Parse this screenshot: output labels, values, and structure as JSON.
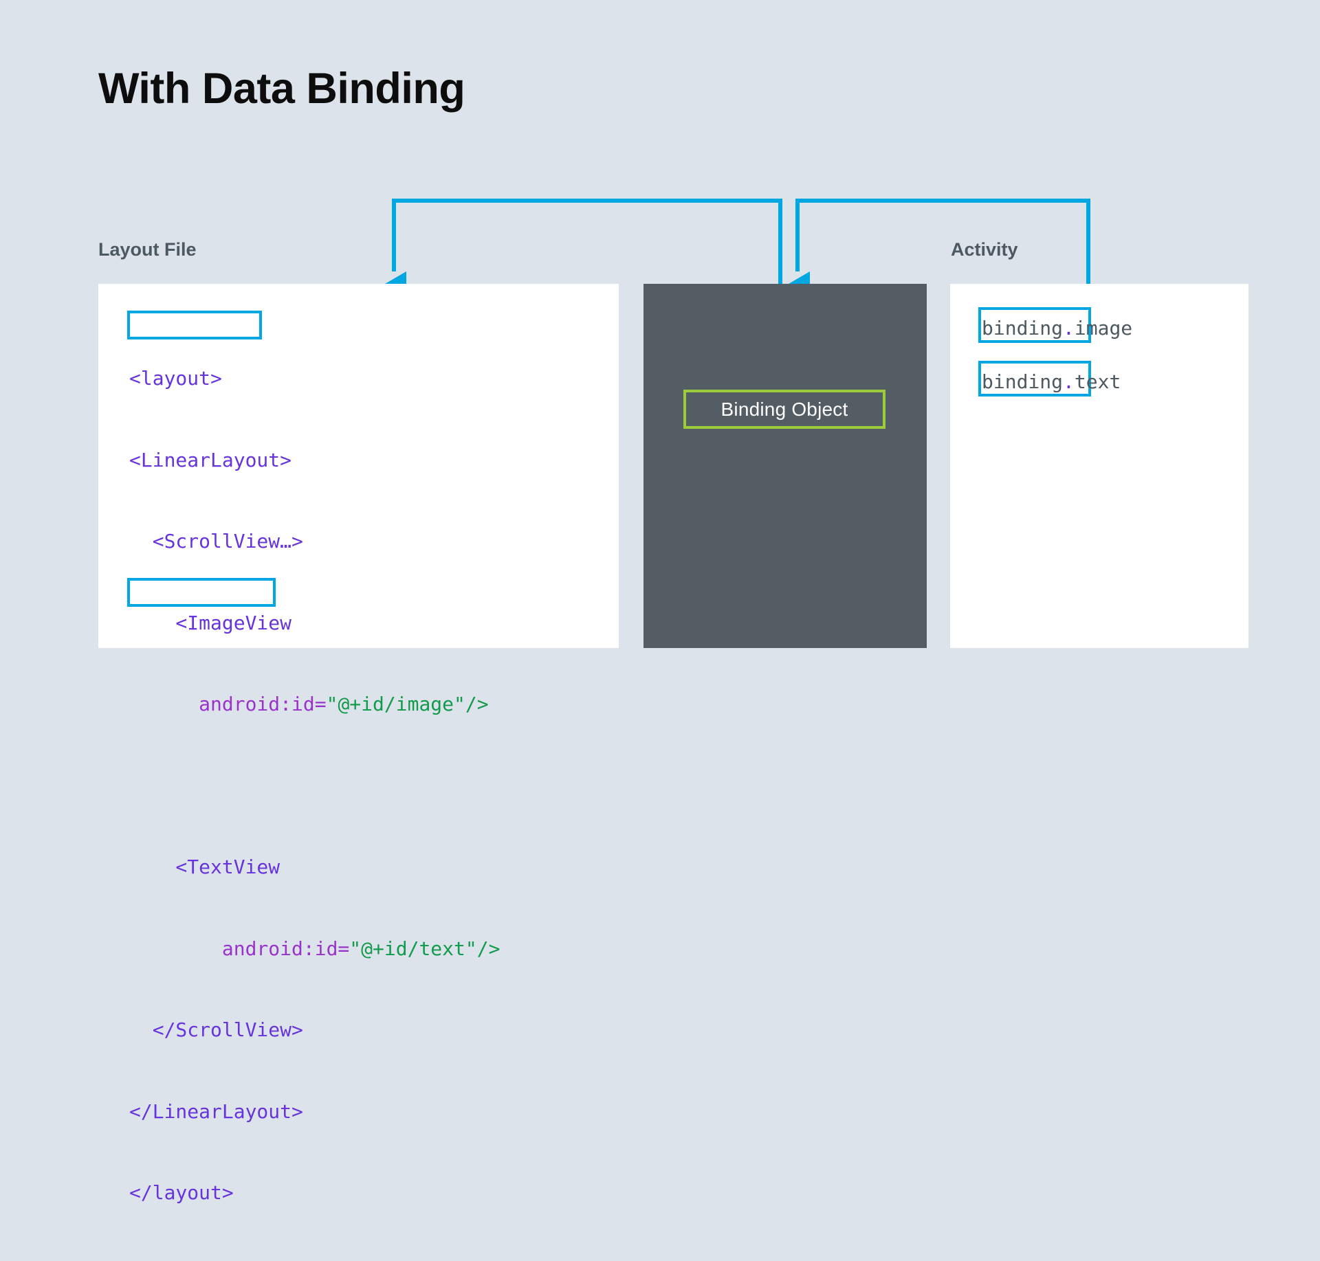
{
  "page": {
    "title": "With Data Binding",
    "background_color": "#dde3ea",
    "accent_color": "#00a7e1",
    "chip_border_color": "#9ccb3b",
    "dark_panel_color": "#545d64",
    "label_color": "#4d5960"
  },
  "labels": {
    "layout_file": "Layout File",
    "activity": "Activity"
  },
  "layout_file_panel": {
    "code_lines": [
      {
        "indent": 0,
        "tag": "<layout>",
        "attr": "",
        "str": "",
        "tail": "",
        "highlighted": true
      },
      {
        "indent": 0,
        "tag": "<LinearLayout>",
        "attr": "",
        "str": "",
        "tail": "",
        "highlighted": false
      },
      {
        "indent": 1,
        "tag": "<ScrollView…>",
        "attr": "",
        "str": "",
        "tail": "",
        "highlighted": false
      },
      {
        "indent": 2,
        "tag": "<ImageView",
        "attr": "",
        "str": "",
        "tail": "",
        "highlighted": false
      },
      {
        "indent": 3,
        "tag": "",
        "attr": "android:id=",
        "str": "\"@+id/image\"",
        "tail": "/>",
        "highlighted": false
      },
      {
        "indent": 0,
        "tag": "",
        "attr": "",
        "str": "",
        "tail": "",
        "highlighted": false
      },
      {
        "indent": 2,
        "tag": "<TextView",
        "attr": "",
        "str": "",
        "tail": "",
        "highlighted": false
      },
      {
        "indent": 3,
        "tag": "",
        "attr": "android:id=",
        "str": "\"@+id/text\"",
        "tail": "/>",
        "highlighted": false
      },
      {
        "indent": 1,
        "tag": "</ScrollView>",
        "attr": "",
        "str": "",
        "tail": "",
        "highlighted": false
      },
      {
        "indent": 0,
        "tag": "</LinearLayout>",
        "attr": "",
        "str": "",
        "tail": "",
        "highlighted": false
      },
      {
        "indent": 0,
        "tag": "</layout>",
        "attr": "",
        "str": "",
        "tail": "",
        "highlighted": true
      }
    ],
    "line_0_text": "<layout>",
    "line_1_text": "<LinearLayout>",
    "line_2_text": "  <ScrollView…>",
    "line_3_text": "    <ImageView",
    "line_4_indent": "      ",
    "line_4_attr": "android:id=",
    "line_4_str": "\"@+id/image\"",
    "line_4_tail": "/>",
    "line_5_text": " ",
    "line_6_text": "    <TextView",
    "line_7_indent": "        ",
    "line_7_attr": "android:id=",
    "line_7_str": "\"@+id/text\"",
    "line_7_tail": "/>",
    "line_8_text": "  </ScrollView>",
    "line_9_text": "</LinearLayout>",
    "line_10_text": "</layout>"
  },
  "binding_object_panel": {
    "chip_label": "Binding Object"
  },
  "activity_panel": {
    "refs": [
      {
        "boxed": "binding",
        "dot": ".",
        "rest": "image"
      },
      {
        "boxed": "binding",
        "dot": ".",
        "rest": "text"
      }
    ],
    "ref_image_boxed": "binding",
    "ref_image_dot": ".",
    "ref_image_rest": "image",
    "ref_text_boxed": "binding",
    "ref_text_dot": ".",
    "ref_text_rest": "text"
  },
  "connectors": [
    {
      "name": "layout-to-binding",
      "description": "From binding object panel up and left, arrow down into Layout File panel"
    },
    {
      "name": "binding-to-activity",
      "description": "From Activity panel up and left, arrow down into Binding Object panel"
    }
  ]
}
